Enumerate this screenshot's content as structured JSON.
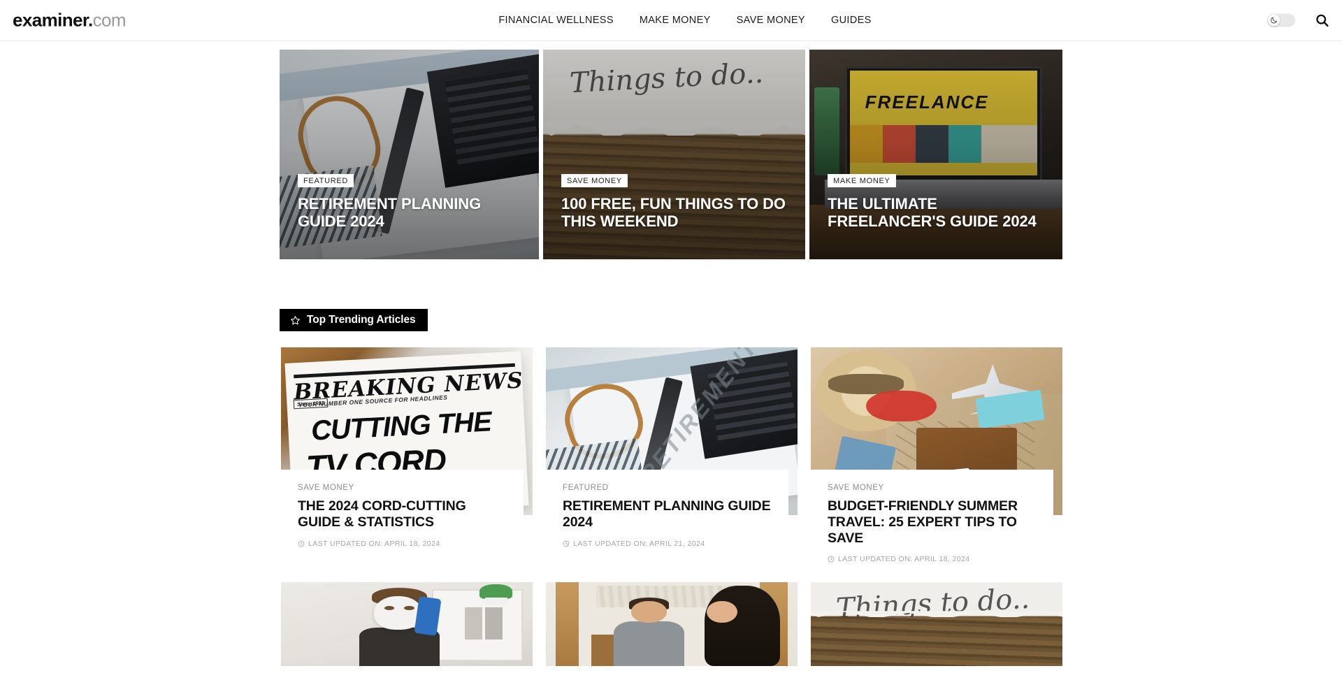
{
  "site": {
    "logo_main": "examiner",
    "logo_dot": ".",
    "logo_com": "com"
  },
  "header": {
    "nav": [
      {
        "label": "FINANCIAL WELLNESS"
      },
      {
        "label": "MAKE MONEY"
      },
      {
        "label": "SAVE MONEY"
      },
      {
        "label": "GUIDES"
      }
    ],
    "dark_mode_icon": "moon-icon",
    "dark_mode_state": "off",
    "search_icon": "search-icon"
  },
  "hero": {
    "cards": [
      {
        "badge": "FEATURED",
        "title": "RETIREMENT PLANNING GUIDE 2024"
      },
      {
        "badge": "SAVE MONEY",
        "title": "100 FREE, FUN THINGS TO DO THIS WEEKEND"
      },
      {
        "badge": "MAKE MONEY",
        "title": "THE ULTIMATE FREELANCER'S GUIDE 2024"
      }
    ]
  },
  "trending": {
    "section_icon": "star-icon",
    "section_title": "Top Trending Articles",
    "date_icon": "clock-icon",
    "cards": [
      {
        "category": "SAVE MONEY",
        "title": "THE 2024 CORD-CUTTING GUIDE & STATISTICS",
        "date": "LAST UPDATED ON: APRIL 18, 2024"
      },
      {
        "category": "FEATURED",
        "title": "RETIREMENT PLANNING GUIDE 2024",
        "date": "LAST UPDATED ON: APRIL 21, 2024"
      },
      {
        "category": "SAVE MONEY",
        "title": "BUDGET-FRIENDLY SUMMER TRAVEL: 25 EXPERT TIPS TO SAVE",
        "date": "LAST UPDATED ON: APRIL 18, 2024"
      }
    ]
  },
  "colors": {
    "accent_black": "#000000",
    "text_primary": "#111111",
    "text_muted": "#8d8d8d",
    "divider": "#efefef",
    "toggle_track": "#e8e8e8"
  }
}
